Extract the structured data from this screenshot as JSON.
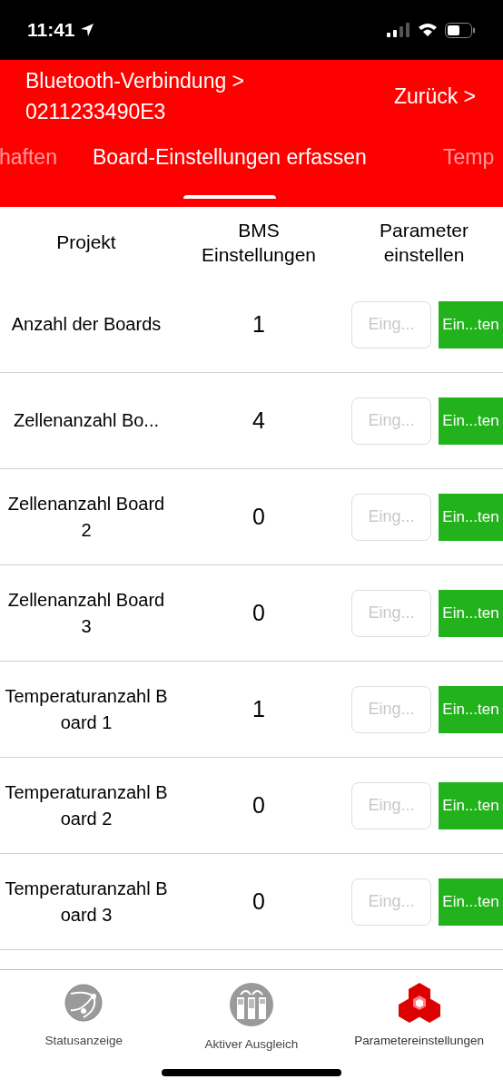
{
  "status_bar": {
    "time": "11:41"
  },
  "header": {
    "breadcrumb": "Bluetooth-Verbindung >",
    "device_id": "0211233490E3",
    "back": "Zurück >"
  },
  "tabs": [
    {
      "label": "haften",
      "selected": false
    },
    {
      "label": "Board-Einstellungen erfassen",
      "selected": true
    },
    {
      "label": "Temp",
      "selected": false
    }
  ],
  "table": {
    "columns": [
      "Projekt",
      "BMS Einstellungen",
      "Parameter einstellen"
    ],
    "rows": [
      {
        "name": "Anzahl der Boards",
        "value": "1",
        "placeholder": "Eing...",
        "button": "Ein...ten"
      },
      {
        "name": "Zellenanzahl Bo...",
        "value": "4",
        "placeholder": "Eing...",
        "button": "Ein...ten"
      },
      {
        "name": "Zellenanzahl Board 2",
        "value": "0",
        "placeholder": "Eing...",
        "button": "Ein...ten"
      },
      {
        "name": "Zellenanzahl Board 3",
        "value": "0",
        "placeholder": "Eing...",
        "button": "Ein...ten"
      },
      {
        "name": "Temperaturanzahl Board 1",
        "value": "1",
        "placeholder": "Eing...",
        "button": "Ein...ten"
      },
      {
        "name": "Temperaturanzahl Board 2",
        "value": "0",
        "placeholder": "Eing...",
        "button": "Ein...ten"
      },
      {
        "name": "Temperaturanzahl Board 3",
        "value": "0",
        "placeholder": "Eing...",
        "button": "Ein...ten"
      }
    ]
  },
  "tab_bar": [
    {
      "kind": "globe",
      "label": "Statusanzeige",
      "selected": false
    },
    {
      "kind": "balance",
      "label": "Aktiver Ausgleich",
      "selected": false
    },
    {
      "kind": "cubes",
      "label": "Parametereinstellungen",
      "selected": true
    }
  ]
}
